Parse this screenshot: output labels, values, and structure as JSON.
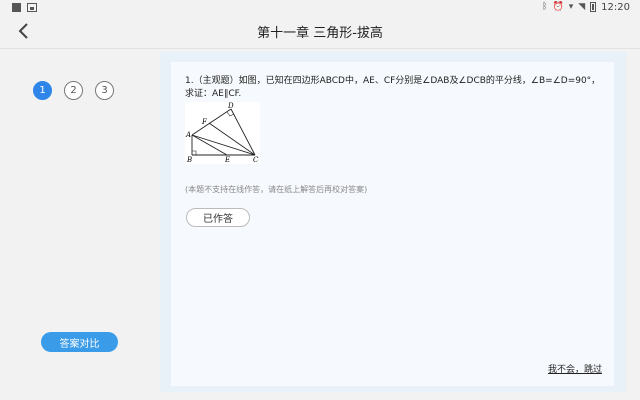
{
  "status_bar": {
    "time": "12:20"
  },
  "app_bar": {
    "title": "第十一章 三角形-拔高"
  },
  "question_nav": {
    "items": [
      "1",
      "2",
      "3"
    ],
    "active_index": 0
  },
  "compare_button": {
    "label": "答案对比"
  },
  "question": {
    "text": "1.（主观题）如图，已知在四边形ABCD中，AE、CF分别是∠DAB及∠DCB的平分线，∠B=∠D=90°，求证：AE∥CF.",
    "figure_labels": {
      "a": "A",
      "b": "B",
      "c": "C",
      "d": "D",
      "e": "E",
      "f": "F"
    },
    "note": "(本题不支持在线作答，请在纸上解答后再校对答案)",
    "answered_label": "已作答"
  },
  "skip": {
    "label": "我不会，跳过"
  },
  "colors": {
    "accent": "#2f86e8",
    "button_blue": "#3a9be8",
    "panel": "#e8f0f8"
  },
  "icons": [
    "square-icon",
    "image-icon",
    "bluetooth-icon",
    "alarm-icon",
    "signal-icon",
    "wifi-icon",
    "battery-icon",
    "back-arrow-icon"
  ]
}
